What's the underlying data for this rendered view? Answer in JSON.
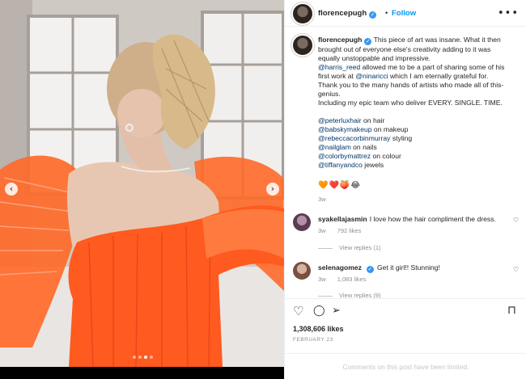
{
  "post": {
    "username": "florencepugh",
    "verified_icon": "verified-badge-icon",
    "follow_label": "Follow",
    "separator": "•",
    "more_label": "•••",
    "caption": {
      "line1": "This piece of art was insane. What it then",
      "line2": "brought out of everyone else's creativity adding to it was",
      "line3": "equally unstoppable and impressive.",
      "line4_mention": "@harris_reed",
      "line4_text": " allowed me to be a part of sharing some of his",
      "line5_text": "first work at ",
      "line5_mention": "@ninaricci",
      "line5_rest": " which I am eternally grateful for.",
      "line6": "Thank you to the many hands of artists who made all of this-",
      "line7": "genius.",
      "line8": "Including my epic team who deliver EVERY. SINGLE. TIME.",
      "credits": [
        {
          "mention": "@peterluxhair",
          "role": " on hair"
        },
        {
          "mention": "@babskymakeup",
          "role": " on makeup"
        },
        {
          "mention": "@rebeccacorbinmurray",
          "role": " styling"
        },
        {
          "mention": "@nailglam",
          "role": " on nails"
        },
        {
          "mention": "@colorbymattrez",
          "role": " on colour"
        },
        {
          "mention": "@tiffanyandco",
          "role": " jewels"
        }
      ],
      "emojis": "🧡❤️🍑😂",
      "time": "3w"
    },
    "comments": [
      {
        "username": "syakellajasmin",
        "text": "I love how the hair compliment the dress.",
        "time": "3w",
        "likes": "792 likes",
        "view_replies": "View replies (1)"
      },
      {
        "username": "selenagomez",
        "text": "Get it girl!! Stunning!",
        "time": "3w",
        "likes": "1,083 likes",
        "view_replies": "View replies (9)"
      }
    ],
    "likes_count": "1,308,606 likes",
    "date": "FEBRUARY 23",
    "comments_limited": "Comments on this post have been limited."
  },
  "icons": {
    "heart": "♡",
    "comment": "◯",
    "share": "➢",
    "save": "⊓",
    "prev": "‹",
    "next": "›"
  },
  "carousel": {
    "dots": 4,
    "active_index": 2
  },
  "colors": {
    "accent": "#0095f6",
    "dress": "#ff5a1f",
    "link": "#00376b"
  }
}
